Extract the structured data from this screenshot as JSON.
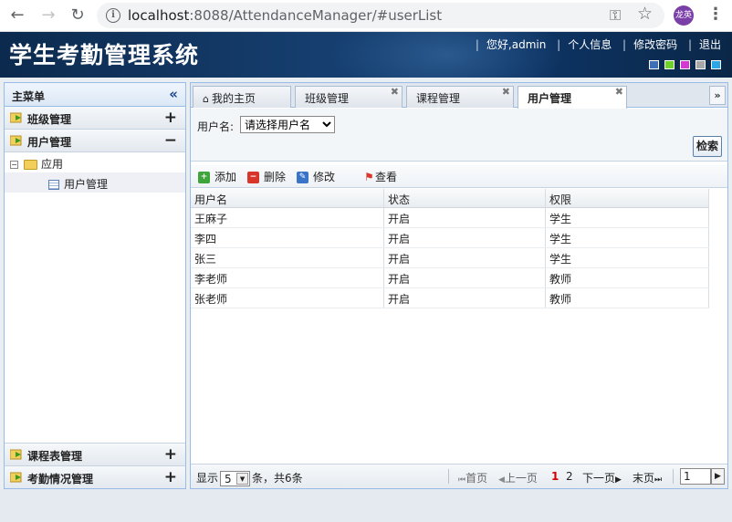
{
  "browser": {
    "url_host": "localhost",
    "url_path": ":8088/AttendanceManager/#userList",
    "profile_label": "龙英"
  },
  "app": {
    "title": "学生考勤管理系统",
    "greeting": "您好,admin",
    "links": [
      "个人信息",
      "修改密码",
      "退出"
    ],
    "theme_colors": [
      "#3c6fb6",
      "#6fd12a",
      "#d23ad0",
      "#a8a8a8",
      "#2aa7e8"
    ]
  },
  "sidebar": {
    "title": "主菜单",
    "top_sections": [
      {
        "label": "班级管理",
        "toggle": "+"
      },
      {
        "label": "用户管理",
        "toggle": "−"
      }
    ],
    "tree": {
      "folder_label": "应用",
      "leaf_label": "用户管理"
    },
    "bottom_sections": [
      {
        "label": "课程表管理",
        "toggle": "+"
      },
      {
        "label": "考勤情况管理",
        "toggle": "+"
      }
    ]
  },
  "tabs": [
    {
      "label": "我的主页",
      "closable": false
    },
    {
      "label": "班级管理",
      "closable": true
    },
    {
      "label": "课程管理",
      "closable": true
    },
    {
      "label": "用户管理",
      "closable": true,
      "active": true
    }
  ],
  "search": {
    "label": "用户名:",
    "select_value": "请选择用户名",
    "button": "检索"
  },
  "toolbar": {
    "add": "添加",
    "delete": "删除",
    "edit": "修改",
    "view": "查看"
  },
  "grid": {
    "columns": [
      "用户名",
      "状态",
      "权限"
    ],
    "rows": [
      [
        "王麻子",
        "开启",
        "学生"
      ],
      [
        "李四",
        "开启",
        "学生"
      ],
      [
        "张三",
        "开启",
        "学生"
      ],
      [
        "李老师",
        "开启",
        "教师"
      ],
      [
        "张老师",
        "开启",
        "教师"
      ]
    ]
  },
  "pager": {
    "show": "显示",
    "page_size": "5",
    "total": "条，共6条",
    "first": "首页",
    "prev": "上一页",
    "pages": [
      "1",
      "2"
    ],
    "next": "下一页",
    "last": "末页",
    "current_page": "1"
  }
}
